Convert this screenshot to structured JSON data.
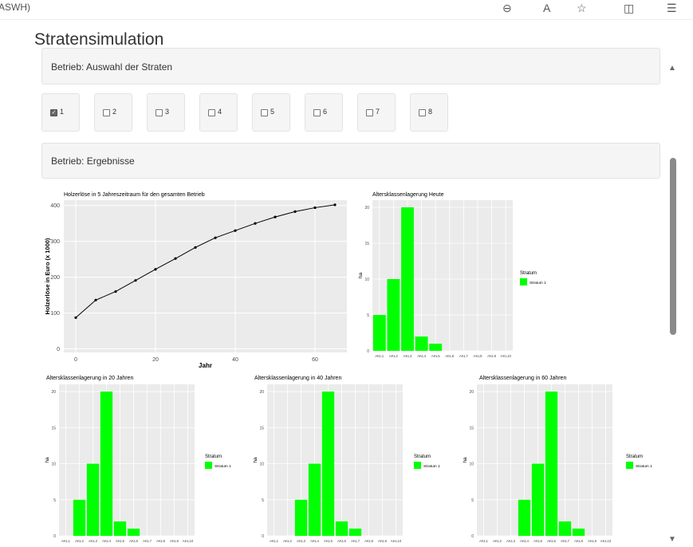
{
  "browser": {
    "left_text": "ASWH)"
  },
  "page": {
    "title": "Stratensimulation"
  },
  "panels": {
    "auswahl": "Betrieb: Auswahl der Straten",
    "ergebnisse": "Betrieb: Ergebnisse"
  },
  "strata_checkboxes": [
    {
      "label": "1",
      "checked": true
    },
    {
      "label": "2",
      "checked": false
    },
    {
      "label": "3",
      "checked": false
    },
    {
      "label": "4",
      "checked": false
    },
    {
      "label": "5",
      "checked": false
    },
    {
      "label": "6",
      "checked": false
    },
    {
      "label": "7",
      "checked": false
    },
    {
      "label": "8",
      "checked": false
    }
  ],
  "colors": {
    "bar": "#00ff00",
    "panel_bg": "#ebebeb"
  },
  "chart_data": [
    {
      "type": "line",
      "title": "Holzerlöse in 5 Jahreszeitraum für den gesamten Betrieb",
      "xlabel": "Jahr",
      "ylabel": "Holzerlöse in Euro (x 1000)",
      "x": [
        0,
        5,
        10,
        15,
        20,
        25,
        30,
        35,
        40,
        45,
        50,
        55,
        60,
        65
      ],
      "y": [
        87,
        136,
        160,
        191,
        222,
        252,
        283,
        310,
        330,
        350,
        368,
        383,
        394,
        402
      ],
      "xticks": [
        "0",
        "20",
        "40",
        "60"
      ],
      "yticks": [
        "0",
        "100",
        "200",
        "300",
        "400"
      ],
      "xlim": [
        -3,
        68
      ],
      "ylim": [
        -10,
        415
      ]
    },
    {
      "type": "bar",
      "title": "Altersklassenlagerung Heute",
      "ylabel": "ha",
      "categories": [
        "AKL1",
        "AKL2",
        "AKL3",
        "AKL4",
        "AKL5",
        "AKL6",
        "AKL7",
        "AKL8",
        "AKL9",
        "AKL10"
      ],
      "values": [
        5,
        10,
        20,
        2,
        1,
        0,
        0,
        0,
        0,
        0
      ],
      "yticks": [
        "0",
        "5",
        "10",
        "15",
        "20"
      ],
      "ylim": [
        0,
        21
      ],
      "legend": {
        "title": "Stratum",
        "entry": "Stratum 1"
      }
    },
    {
      "type": "bar",
      "title": "Altersklassenlagerung in 20 Jahren",
      "ylabel": "ha",
      "categories": [
        "AKL1",
        "AKL2",
        "AKL3",
        "AKL4",
        "AKL5",
        "AKL6",
        "AKL7",
        "AKL8",
        "AKL9",
        "AKL10"
      ],
      "values": [
        0,
        5,
        10,
        20,
        2,
        1,
        0,
        0,
        0,
        0
      ],
      "yticks": [
        "0",
        "5",
        "10",
        "15",
        "20"
      ],
      "ylim": [
        0,
        21
      ],
      "legend": {
        "title": "Stratum",
        "entry": "Stratum 1"
      }
    },
    {
      "type": "bar",
      "title": "Altersklassenlagerung in 40 Jahren",
      "ylabel": "ha",
      "categories": [
        "AKL1",
        "AKL2",
        "AKL3",
        "AKL4",
        "AKL5",
        "AKL6",
        "AKL7",
        "AKL8",
        "AKL9",
        "AKL10"
      ],
      "values": [
        0,
        0,
        5,
        10,
        20,
        2,
        1,
        0,
        0,
        0
      ],
      "yticks": [
        "0",
        "5",
        "10",
        "15",
        "20"
      ],
      "ylim": [
        0,
        21
      ],
      "legend": {
        "title": "Stratum",
        "entry": "Stratum 1"
      }
    },
    {
      "type": "bar",
      "title": "Altersklassenlagerung in 60 Jahren",
      "ylabel": "ha",
      "categories": [
        "AKL1",
        "AKL2",
        "AKL3",
        "AKL4",
        "AKL5",
        "AKL6",
        "AKL7",
        "AKL8",
        "AKL9",
        "AKL10"
      ],
      "values": [
        0,
        0,
        0,
        5,
        10,
        20,
        2,
        1,
        0,
        0
      ],
      "yticks": [
        "0",
        "5",
        "10",
        "15",
        "20"
      ],
      "ylim": [
        0,
        21
      ],
      "legend": {
        "title": "Stratum",
        "entry": "Stratum 1"
      }
    }
  ]
}
